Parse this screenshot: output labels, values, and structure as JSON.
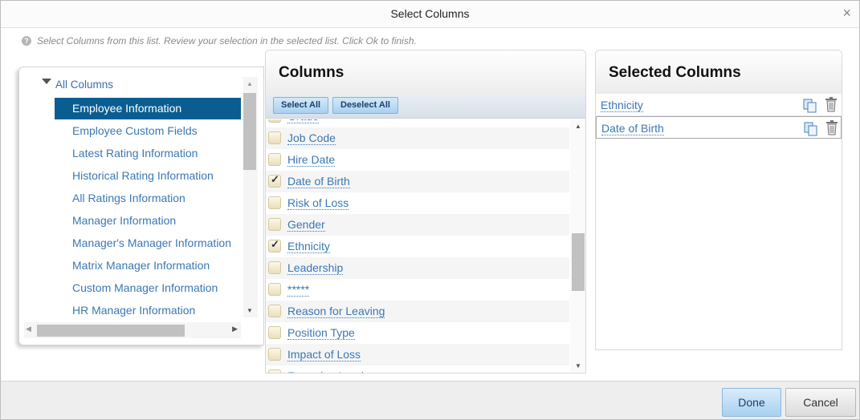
{
  "dialog": {
    "title": "Select Columns",
    "close_glyph": "×",
    "instructions": "Select Columns from this list. Review your selection in the selected list. Click Ok to finish.",
    "help_glyph": "?"
  },
  "tree": {
    "root_label": "All Columns",
    "items": [
      {
        "label": "Employee Information",
        "selected": true
      },
      {
        "label": "Employee Custom Fields",
        "selected": false
      },
      {
        "label": "Latest Rating Information",
        "selected": false
      },
      {
        "label": "Historical Rating Information",
        "selected": false
      },
      {
        "label": "All Ratings Information",
        "selected": false
      },
      {
        "label": "Manager Information",
        "selected": false
      },
      {
        "label": "Manager's Manager Information",
        "selected": false
      },
      {
        "label": "Matrix Manager Information",
        "selected": false
      },
      {
        "label": "Custom Manager Information",
        "selected": false
      },
      {
        "label": "HR Manager Information",
        "selected": false
      }
    ]
  },
  "columns_panel": {
    "title": "Columns",
    "select_all_label": "Select All",
    "deselect_all_label": "Deselect All",
    "rows": [
      {
        "label": "Grade",
        "checked": false
      },
      {
        "label": "Job Code",
        "checked": false
      },
      {
        "label": "Hire Date",
        "checked": false
      },
      {
        "label": "Date of Birth",
        "checked": true
      },
      {
        "label": "Risk of Loss",
        "checked": false
      },
      {
        "label": "Gender",
        "checked": false
      },
      {
        "label": "Ethnicity",
        "checked": true
      },
      {
        "label": "Leadership",
        "checked": false
      },
      {
        "label": "*****",
        "checked": false
      },
      {
        "label": "Reason for Leaving",
        "checked": false
      },
      {
        "label": "Position Type",
        "checked": false
      },
      {
        "label": "Impact of Loss",
        "checked": false
      },
      {
        "label": "Emerging Leader",
        "checked": false
      }
    ]
  },
  "selected_panel": {
    "title": "Selected Columns",
    "items": [
      {
        "label": "Ethnicity"
      },
      {
        "label": "Date of Birth"
      }
    ]
  },
  "footer": {
    "done_label": "Done",
    "cancel_label": "Cancel"
  }
}
